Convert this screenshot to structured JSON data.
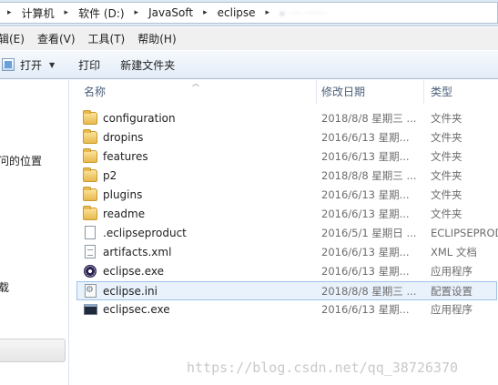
{
  "address": {
    "crumbs": [
      "计算机",
      "软件 (D:)",
      "JavaSoft",
      "eclipse"
    ],
    "trailing_blur": "▸ ···· ·······"
  },
  "menu": [
    "(E)编辑(E)",
    "查看(V)",
    "工具(T)",
    "帮助(H)"
  ],
  "menu_display": [
    "辑(E)",
    "查看(V)",
    "工具(T)",
    "帮助(H)"
  ],
  "toolbar": {
    "open_label": "打开",
    "print_label": "打印",
    "new_folder_label": "新建文件夹"
  },
  "nav": {
    "recent_label": "问的位置",
    "download_label": "载"
  },
  "columns": {
    "name": "名称",
    "date": "修改日期",
    "type": "类型"
  },
  "files": [
    {
      "name": "configuration",
      "date": "2018/8/8 星期三 ...",
      "type": "文件夹",
      "icon": "folder-icon"
    },
    {
      "name": "dropins",
      "date": "2016/6/13 星期...",
      "type": "文件夹",
      "icon": "folder-icon"
    },
    {
      "name": "features",
      "date": "2016/6/13 星期...",
      "type": "文件夹",
      "icon": "folder-icon"
    },
    {
      "name": "p2",
      "date": "2018/8/8 星期三 ...",
      "type": "文件夹",
      "icon": "folder-icon"
    },
    {
      "name": "plugins",
      "date": "2016/6/13 星期...",
      "type": "文件夹",
      "icon": "folder-icon"
    },
    {
      "name": "readme",
      "date": "2016/6/13 星期...",
      "type": "文件夹",
      "icon": "folder-icon"
    },
    {
      "name": ".eclipseproduct",
      "date": "2016/5/1 星期日 ...",
      "type": "ECLIPSEPRODUCT",
      "icon": "file-icon"
    },
    {
      "name": "artifacts.xml",
      "date": "2016/6/13 星期...",
      "type": "XML 文档",
      "icon": "xml-file-icon"
    },
    {
      "name": "eclipse.exe",
      "date": "2016/6/13 星期...",
      "type": "应用程序",
      "icon": "eclipse-app-icon"
    },
    {
      "name": "eclipse.ini",
      "date": "2018/8/8 星期三 ...",
      "type": "配置设置",
      "icon": "config-file-icon",
      "selected": true
    },
    {
      "name": "eclipsec.exe",
      "date": "2016/6/13 星期...",
      "type": "应用程序",
      "icon": "console-app-icon"
    }
  ],
  "watermark": "https://blog.csdn.net/qq_38726370"
}
